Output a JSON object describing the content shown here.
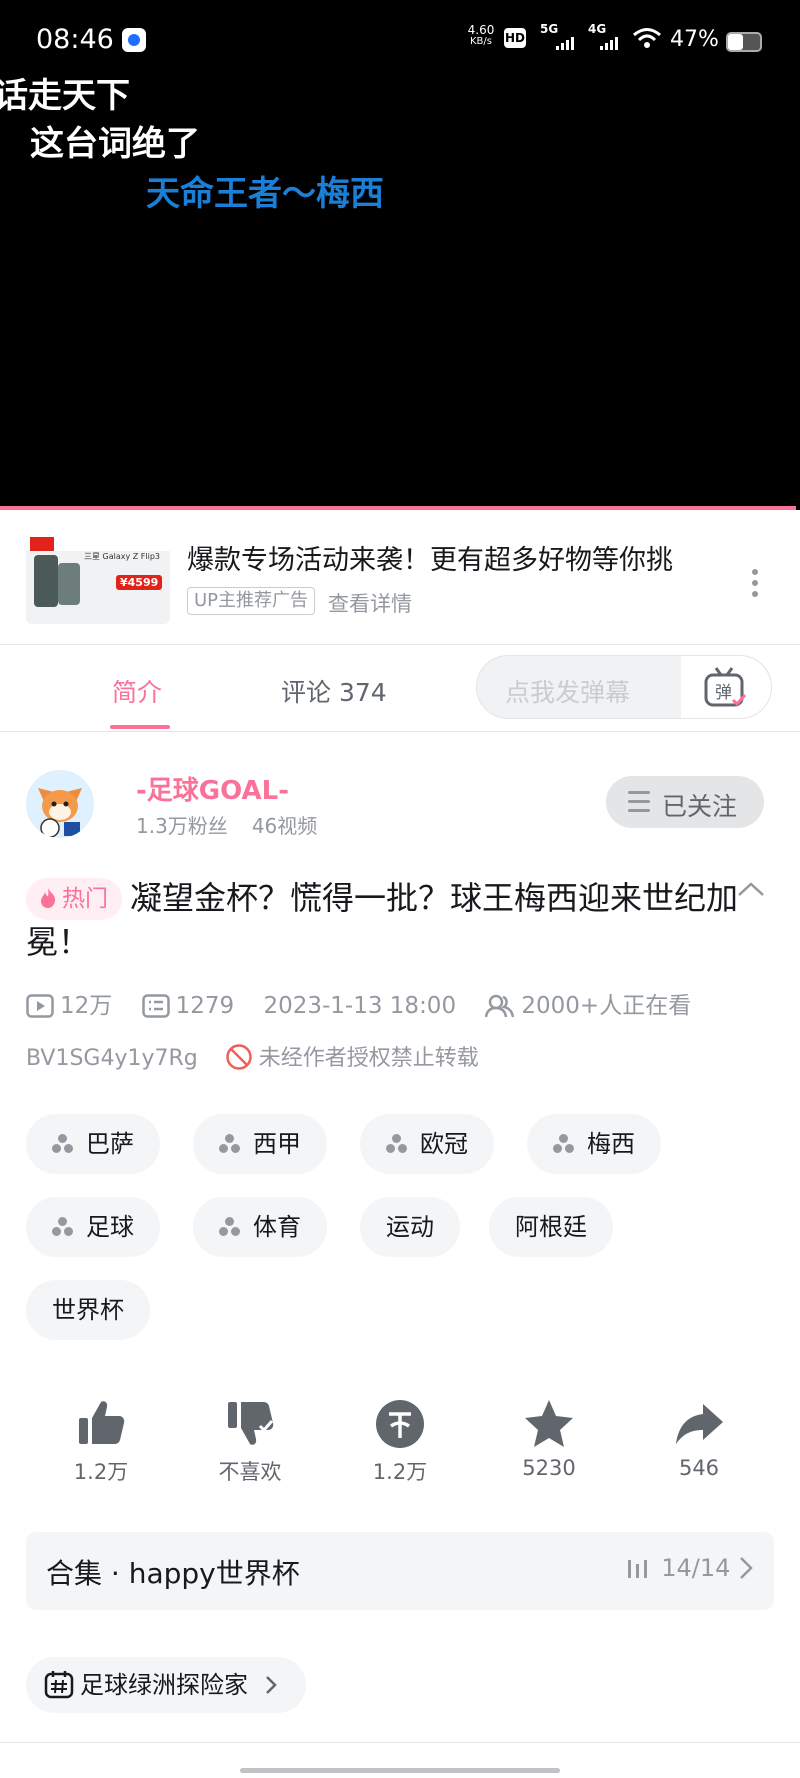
{
  "status_bar": {
    "time": "08:46",
    "net_speed_value": "4.60",
    "net_speed_unit": "KB/s",
    "hd": "HD",
    "sim1": "5G",
    "sim2": "4G",
    "battery_percent": "47%",
    "battery_level": 0.47
  },
  "video": {
    "danmaku": [
      {
        "text": "话走天下",
        "color": "#ffffff"
      },
      {
        "text": "这台词绝了",
        "color": "#ffffff"
      },
      {
        "text": "天命王者～梅西",
        "color": "#1a7fd6"
      }
    ],
    "progress_fraction": 0.995,
    "accent_color": "#fb7299"
  },
  "ad": {
    "title": "爆款专场活动来袭！更有超多好物等你挑",
    "tag": "UP主推荐广告",
    "detail_link": "查看详情",
    "thumb_text": "三星 Galaxy Z Flip3",
    "thumb_price": "¥4599"
  },
  "tabs": {
    "intro": "简介",
    "comments": "评论 374",
    "danmaku_placeholder": "点我发弹幕",
    "danmaku_button_char": "弹"
  },
  "author": {
    "name": "-足球GOAL-",
    "fans": "1.3万粉丝",
    "videos": "46视频",
    "follow_label": "已关注"
  },
  "video_info": {
    "hot_badge": "热门",
    "title": "凝望金杯？慌得一批？球王梅西迎来世纪加冕！",
    "plays": "12万",
    "danmaku_count": "1279",
    "datetime": "2023-1-13 18:00",
    "watching": "2000+人正在看",
    "bvid": "BV1SG4y1y7Rg",
    "copyright": "未经作者授权禁止转载"
  },
  "tags": [
    {
      "label": "巴萨",
      "channel": true
    },
    {
      "label": "西甲",
      "channel": true
    },
    {
      "label": "欧冠",
      "channel": true
    },
    {
      "label": "梅西",
      "channel": true
    },
    {
      "label": "足球",
      "channel": true
    },
    {
      "label": "体育",
      "channel": true
    },
    {
      "label": "运动",
      "channel": false
    },
    {
      "label": "阿根廷",
      "channel": false
    },
    {
      "label": "世界杯",
      "channel": false
    }
  ],
  "actions": {
    "like": "1.2万",
    "dislike": "不喜欢",
    "coin": "1.2万",
    "favorite": "5230",
    "share": "546"
  },
  "collection": {
    "label": "合集 · happy世界杯",
    "count": "14/14"
  },
  "topic": {
    "label": "足球绿洲探险家"
  }
}
